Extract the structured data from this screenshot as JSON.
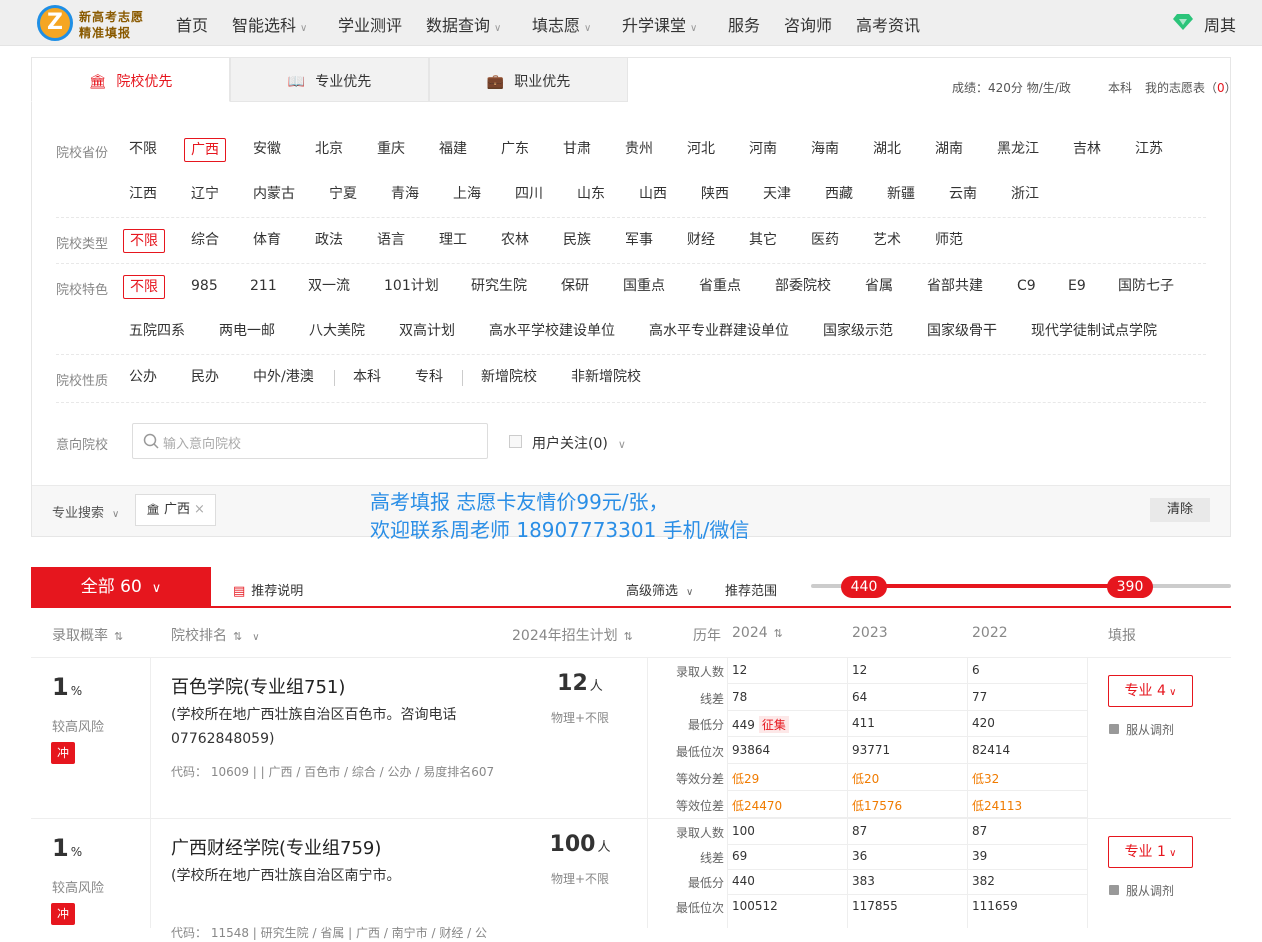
{
  "logo": {
    "line1": "新高考志愿",
    "line2": "精准填报"
  },
  "nav": {
    "items": [
      {
        "label": "首页",
        "dropdown": false
      },
      {
        "label": "智能选科",
        "dropdown": true
      },
      {
        "label": "学业测评",
        "dropdown": false
      },
      {
        "label": "数据查询",
        "dropdown": true
      },
      {
        "label": "填志愿",
        "dropdown": true
      },
      {
        "label": "升学课堂",
        "dropdown": true
      },
      {
        "label": "服务",
        "dropdown": false
      },
      {
        "label": "咨询师",
        "dropdown": false
      },
      {
        "label": "高考资讯",
        "dropdown": false
      }
    ],
    "user": "周其"
  },
  "tabs": [
    {
      "label": "院校优先",
      "active": true
    },
    {
      "label": "专业优先",
      "active": false
    },
    {
      "label": "职业优先",
      "active": false
    }
  ],
  "score_bar": {
    "score_label": "成绩：",
    "score_value": "420分 物/生/政",
    "level": "本科",
    "my_table": "我的志愿表",
    "paren_open": "（",
    "count": "0",
    "paren_close": "）"
  },
  "filters": {
    "province": {
      "label": "院校省份",
      "row1": [
        "不限",
        "广西",
        "安徽",
        "北京",
        "重庆",
        "福建",
        "广东",
        "甘肃",
        "贵州",
        "河北",
        "河南",
        "海南",
        "湖北",
        "湖南",
        "黑龙江",
        "吉林",
        "江苏"
      ],
      "row2": [
        "江西",
        "辽宁",
        "内蒙古",
        "宁夏",
        "青海",
        "上海",
        "四川",
        "山东",
        "山西",
        "陕西",
        "天津",
        "西藏",
        "新疆",
        "云南",
        "浙江"
      ]
    },
    "type": {
      "label": "院校类型",
      "options": [
        "不限",
        "综合",
        "体育",
        "政法",
        "语言",
        "理工",
        "农林",
        "民族",
        "军事",
        "财经",
        "其它",
        "医药",
        "艺术",
        "师范"
      ]
    },
    "feature": {
      "label": "院校特色",
      "row1": [
        "不限",
        "985",
        "211",
        "双一流",
        "101计划",
        "研究生院",
        "保研",
        "国重点",
        "省重点",
        "部委院校",
        "省属",
        "省部共建",
        "C9",
        "E9",
        "国防七子"
      ],
      "row2": [
        "五院四系",
        "两电一邮",
        "八大美院",
        "双高计划",
        "高水平学校建设单位",
        "高水平专业群建设单位",
        "国家级示范",
        "国家级骨干",
        "现代学徒制试点学院"
      ]
    },
    "nature": {
      "label": "院校性质",
      "options": [
        "公办",
        "民办",
        "中外/港澳",
        "本科",
        "专科",
        "新增院校",
        "非新增院校"
      ]
    },
    "intent": {
      "label": "意向院校",
      "placeholder": "输入意向院校",
      "follow": "用户关注(0)"
    }
  },
  "bottom_bar": {
    "search_label": "专业搜索",
    "tag": "广西",
    "promo_line1": "高考填报 志愿卡友情价99元/张，",
    "promo_line2": "欢迎联系周老师 18907773301  手机/微信",
    "clear": "清除"
  },
  "result_bar": {
    "all": "全部 60",
    "explain": "推荐说明",
    "advanced": "高级筛选",
    "range_label": "推荐范围",
    "range_low": "440",
    "range_high": "390"
  },
  "table_header": {
    "prob": "录取概率",
    "rank": "院校排名",
    "plan": "2024年招生计划",
    "year": "历年",
    "y1": "2024",
    "y2": "2023",
    "y3": "2022",
    "fill": "填报"
  },
  "row_labels": [
    "录取人数",
    "线差",
    "最低分",
    "最低位次",
    "等效分差",
    "等效位差"
  ],
  "cards": [
    {
      "prob": "1",
      "prob_unit": "%",
      "risk": "较高风险",
      "badge": "冲",
      "name": "百色学院(专业组751)",
      "addr": "(学校所在地广西壮族自治区百色市。咨询电话07762848059)",
      "meta": "代码： 10609  |     |  广西 / 百色市 / 综合 / 公办 / 易度排名607",
      "plan": "12",
      "plan_unit": "人",
      "plan_sub": "物理+不限",
      "y2024": [
        "12",
        "78",
        "449",
        "93864",
        "低29",
        "低24470"
      ],
      "y2023": [
        "12",
        "64",
        "411",
        "93771",
        "低20",
        "低17576"
      ],
      "y2022": [
        "6",
        "77",
        "420",
        "82414",
        "低32",
        "低24113"
      ],
      "tag_2024_min": "征集",
      "major_btn": "专业 4",
      "obey": "服从调剂"
    },
    {
      "prob": "1",
      "prob_unit": "%",
      "risk": "较高风险",
      "badge": "冲",
      "name": "广西财经学院(专业组759)",
      "addr": "(学校所在地广西壮族自治区南宁市。",
      "meta": "代码： 11548  |  研究生院 / 省属  |  广西 / 南宁市 / 财经 / 公",
      "plan": "100",
      "plan_unit": "人",
      "plan_sub": "物理+不限",
      "y2024": [
        "100",
        "69",
        "440",
        "100512"
      ],
      "y2023": [
        "87",
        "36",
        "383",
        "117855"
      ],
      "y2022": [
        "87",
        "39",
        "382",
        "111659"
      ],
      "major_btn": "专业 1",
      "obey": "服从调剂"
    }
  ]
}
